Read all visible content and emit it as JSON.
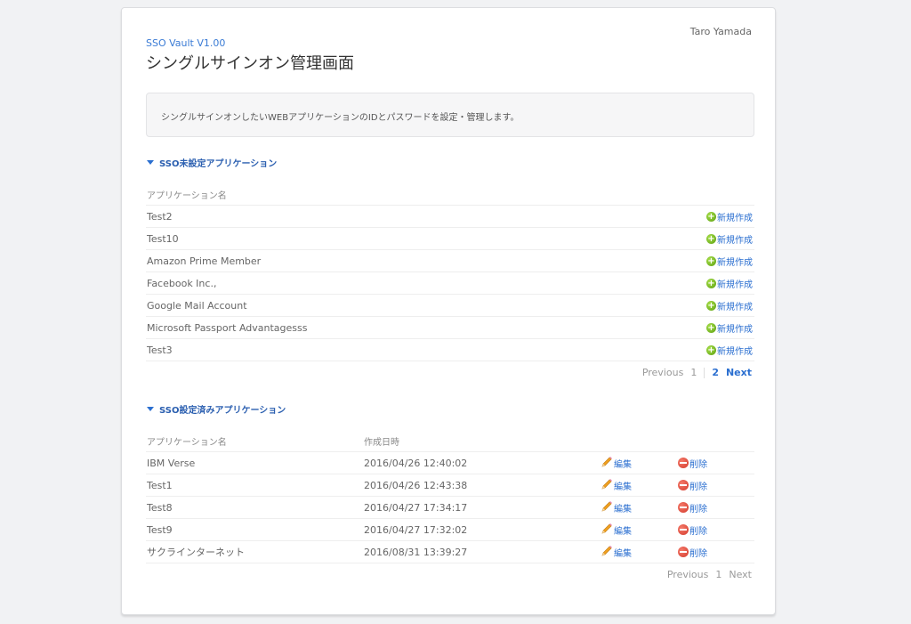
{
  "header": {
    "user_name": "Taro Yamada",
    "app_version": "SSO Vault V1.00",
    "page_title": "シングルサインオン管理画面"
  },
  "info": {
    "text": "シングルサインオンしたいWEBアプリケーションのIDとパスワードを設定・管理します。"
  },
  "unconfigured": {
    "title": "SSO未設定アプリケーション",
    "columns": [
      "アプリケーション名"
    ],
    "action_label": "新規作成",
    "action_icon": "plus-circle-icon",
    "rows": [
      {
        "name": "Test2"
      },
      {
        "name": "Test10"
      },
      {
        "name": "Amazon Prime Member"
      },
      {
        "name": "Facebook Inc.,"
      },
      {
        "name": "Google Mail Account"
      },
      {
        "name": "Microsoft Passport Advantagesss"
      },
      {
        "name": "Test3"
      }
    ],
    "pager": {
      "previous": "Previous",
      "pages": [
        "1",
        "2"
      ],
      "current": "2",
      "next": "Next"
    }
  },
  "configured": {
    "title": "SSO設定済みアプリケーション",
    "columns": [
      "アプリケーション名",
      "作成日時"
    ],
    "edit_label": "編集",
    "delete_label": "削除",
    "edit_icon": "pencil-icon",
    "delete_icon": "minus-circle-icon",
    "rows": [
      {
        "name": "IBM Verse",
        "created": "2016/04/26 12:40:02"
      },
      {
        "name": "Test1",
        "created": "2016/04/26 12:43:38"
      },
      {
        "name": "Test8",
        "created": "2016/04/27 17:34:17"
      },
      {
        "name": "Test9",
        "created": "2016/04/27 17:32:02"
      },
      {
        "name": "サクラインターネット",
        "created": "2016/08/31 13:39:27"
      }
    ],
    "pager": {
      "previous": "Previous",
      "pages": [
        "1"
      ],
      "current": "1",
      "next": "Next"
    }
  },
  "colors": {
    "accent": "#2b6fd0",
    "add": "#6cb41c",
    "delete": "#e0473a"
  }
}
